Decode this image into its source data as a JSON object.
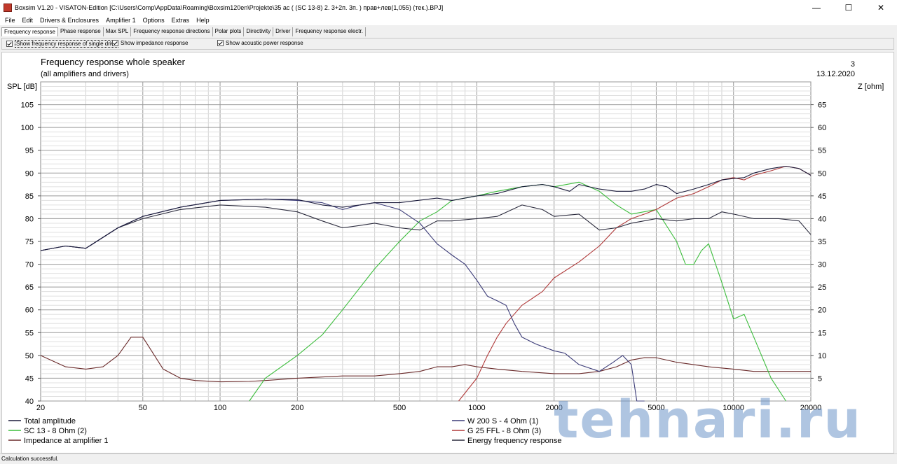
{
  "window": {
    "title": "Boxsim V1.20 - VISATON-Edition [C:\\Users\\Comp\\AppData\\Roaming\\Boxsim120en\\Projekte\\35 ac (  (SC 13-8)  2. 3+2п. 3п. )  прав+лев(1,055) (тек.).BPJ]",
    "icon": "boxsim-app-icon",
    "minimize": "—",
    "maximize": "☐",
    "close": "✕"
  },
  "menu": [
    "File",
    "Edit",
    "Drivers & Enclosures",
    "Amplifier 1",
    "Options",
    "Extras",
    "Help"
  ],
  "tabs": [
    "Frequency response",
    "Phase response",
    "Max SPL",
    "Frequency response directions",
    "Polar plots",
    "Directivity",
    "Driver",
    "Frequency response electr."
  ],
  "active_tab": 0,
  "options": [
    {
      "label": "Show frequency response of single drive",
      "checked": true
    },
    {
      "label": "Show impedance response",
      "checked": true
    },
    {
      "label": "Show acoustic power response",
      "checked": true
    }
  ],
  "chart_header": {
    "title": "Frequency response whole speaker",
    "subtitle": "(all amplifiers and drivers)",
    "number": "3",
    "date": "13.12.2020"
  },
  "status": "Calculation successful.",
  "watermark": "tehnari.ru",
  "chart_data": {
    "type": "line",
    "x_scale": "log",
    "xlim": [
      20,
      20000
    ],
    "xticks": [
      20,
      50,
      100,
      200,
      500,
      1000,
      2000,
      5000,
      10000,
      20000
    ],
    "xtick_labels": [
      "20",
      "50",
      "100",
      "200",
      "500",
      "1000",
      "2000",
      "5000",
      "10000",
      "20000"
    ],
    "ylabel": "SPL [dB]",
    "ylim": [
      40,
      110
    ],
    "yticks": [
      40,
      45,
      50,
      55,
      60,
      65,
      70,
      75,
      80,
      85,
      90,
      95,
      100,
      105
    ],
    "y2label": "Z [ohm]",
    "y2lim": [
      0,
      70
    ],
    "y2ticks": [
      5,
      10,
      15,
      20,
      25,
      30,
      35,
      40,
      45,
      50,
      55,
      60,
      65
    ],
    "grid": true,
    "series": [
      {
        "name": "Total amplitude",
        "color": "#1a1a3a",
        "axis": "left",
        "x": [
          20,
          25,
          30,
          40,
          50,
          70,
          100,
          150,
          200,
          250,
          300,
          350,
          400,
          500,
          700,
          800,
          1000,
          1200,
          1500,
          1800,
          2000,
          2300,
          2500,
          3000,
          3500,
          4000,
          4500,
          5000,
          5500,
          6000,
          7000,
          8000,
          9000,
          10000,
          11000,
          12000,
          14000,
          16000,
          18000,
          20000
        ],
        "y": [
          73,
          74,
          73.5,
          78,
          80.5,
          82.5,
          84,
          84.3,
          84.2,
          83,
          82.5,
          83,
          83.5,
          83.5,
          84.5,
          84,
          85,
          85.5,
          87,
          87.5,
          87,
          86,
          87.5,
          86.5,
          86,
          86,
          86.5,
          87.5,
          87,
          85.5,
          86.5,
          87.5,
          88.5,
          88.8,
          89,
          90,
          91,
          91.5,
          91,
          89.5
        ]
      },
      {
        "name": "SC 13 - 8 Ohm (2)",
        "color": "#3cbd3c",
        "axis": "left",
        "x": [
          130,
          150,
          200,
          250,
          300,
          400,
          500,
          600,
          700,
          800,
          1000,
          1200,
          1500,
          1800,
          2000,
          2500,
          3000,
          3500,
          4000,
          5000,
          6000,
          6500,
          7000,
          7500,
          8000,
          9000,
          10000,
          11000,
          12000,
          14000,
          16000
        ],
        "y": [
          40,
          45,
          50,
          54.5,
          60,
          69,
          75,
          79.5,
          81.5,
          84,
          85,
          86,
          87,
          87.5,
          87,
          88,
          86,
          83,
          81,
          82,
          75,
          70,
          70,
          73,
          74.5,
          66,
          58,
          59,
          54,
          45,
          40
        ]
      },
      {
        "name": "Impedance at amplifier 1",
        "color": "#6a2a2a",
        "axis": "right",
        "x": [
          20,
          25,
          30,
          35,
          40,
          45,
          50,
          60,
          70,
          80,
          100,
          130,
          150,
          200,
          300,
          400,
          500,
          600,
          700,
          800,
          900,
          1000,
          1200,
          1500,
          2000,
          2500,
          3000,
          3500,
          4000,
          4500,
          5000,
          6000,
          8000,
          10000,
          12000,
          15000,
          20000
        ],
        "y": [
          10,
          7.5,
          7,
          7.5,
          10,
          14,
          14,
          7,
          5,
          4.5,
          4.2,
          4.3,
          4.5,
          5,
          5.5,
          5.5,
          6,
          6.5,
          7.5,
          7.5,
          8,
          7.5,
          7,
          6.5,
          6,
          6,
          6.5,
          7.5,
          9,
          9.5,
          9.5,
          8.5,
          7.5,
          7,
          6.5,
          6.5,
          6.5
        ]
      },
      {
        "name": "W 200 S - 4 Ohm (1)",
        "color": "#3c3c78",
        "axis": "left",
        "x": [
          20,
          25,
          30,
          40,
          50,
          70,
          100,
          150,
          200,
          250,
          300,
          350,
          400,
          500,
          600,
          700,
          800,
          900,
          1000,
          1100,
          1200,
          1300,
          1400,
          1500,
          1700,
          2000,
          2200,
          2500,
          3000,
          3400,
          3700,
          4000,
          4200,
          4500
        ],
        "y": [
          73,
          74,
          73.5,
          78,
          80.5,
          82.5,
          84,
          84.3,
          84,
          83.5,
          82,
          83,
          83.5,
          82,
          79,
          74.5,
          72,
          70,
          66.5,
          63,
          62,
          61,
          57,
          54,
          52.5,
          51,
          50.5,
          48,
          46.5,
          48.5,
          50,
          48,
          40,
          38
        ]
      },
      {
        "name": "G 25 FFL - 8 Ohm (3)",
        "color": "#b03a3a",
        "axis": "left",
        "x": [
          850,
          1000,
          1100,
          1200,
          1300,
          1500,
          1800,
          2000,
          2500,
          3000,
          3500,
          4000,
          4500,
          5000,
          6000,
          7000,
          8000,
          9000,
          10000,
          11000,
          12000,
          14000,
          16000,
          18000,
          20000
        ],
        "y": [
          40,
          45,
          50,
          54,
          57,
          61,
          64,
          67,
          70.5,
          74,
          78,
          80,
          81,
          82,
          84.5,
          85.5,
          87,
          88.5,
          89,
          88.5,
          89.5,
          90.5,
          91.5,
          91,
          89.5
        ]
      },
      {
        "name": "Energy frequency response",
        "color": "#2b2b3d",
        "axis": "left",
        "x": [
          20,
          25,
          30,
          40,
          50,
          70,
          100,
          150,
          200,
          250,
          300,
          350,
          400,
          500,
          600,
          700,
          800,
          1000,
          1200,
          1500,
          1800,
          2000,
          2500,
          3000,
          3500,
          4000,
          5000,
          6000,
          7000,
          8000,
          9000,
          10000,
          12000,
          15000,
          18000,
          20000
        ],
        "y": [
          73,
          74,
          73.5,
          78,
          80,
          82,
          83,
          82.5,
          81.5,
          79.5,
          78,
          78.5,
          79,
          78,
          77.5,
          79.5,
          79.5,
          80,
          80.5,
          83,
          82,
          80.5,
          81,
          77.5,
          78,
          79,
          80,
          79.5,
          80,
          80,
          81.5,
          81,
          80,
          80,
          79.5,
          76.5
        ]
      }
    ]
  },
  "legend": [
    {
      "label": "Total amplitude",
      "color": "#1a1a3a"
    },
    {
      "label": "SC 13 - 8 Ohm (2)",
      "color": "#3cbd3c"
    },
    {
      "label": "Impedance at amplifier 1",
      "color": "#6a2a2a"
    },
    {
      "label": "W 200 S - 4 Ohm (1)",
      "color": "#3c3c78"
    },
    {
      "label": "G 25 FFL - 8 Ohm (3)",
      "color": "#b03a3a"
    },
    {
      "label": "Energy frequency response",
      "color": "#2b2b3d"
    }
  ]
}
